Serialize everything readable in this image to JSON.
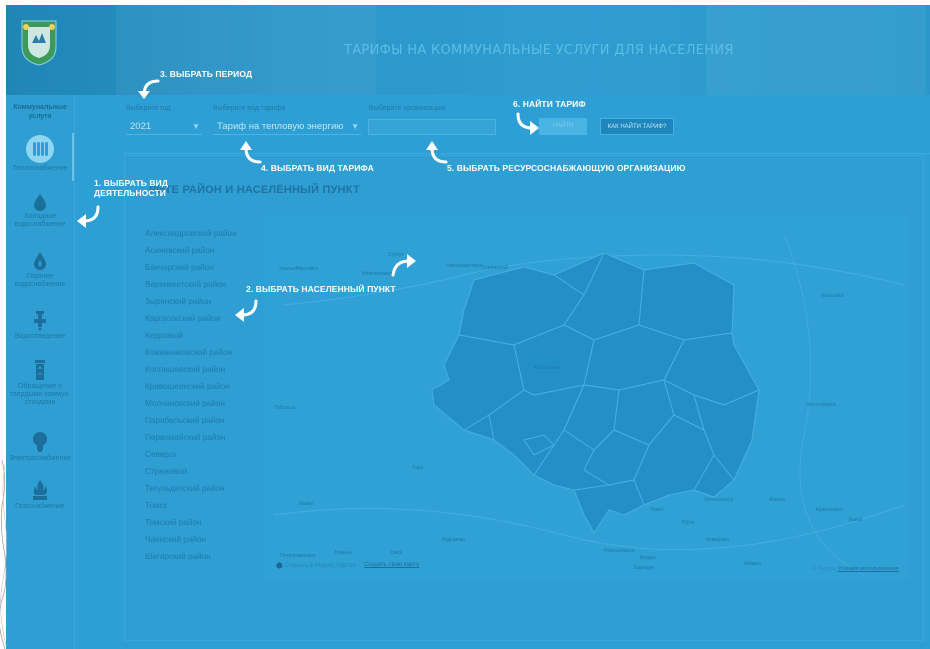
{
  "header": {
    "title": "ТАРИФЫ НА КОММУНАЛЬНЫЕ УСЛУГИ ДЛЯ НАСЕЛЕНИЯ"
  },
  "sidebar": {
    "heading": "Коммунальные услуги",
    "items": [
      {
        "label": "Теплоснабжение",
        "icon": "radiator-icon"
      },
      {
        "label": "Холодное водоснабжение",
        "icon": "cold-water-drop-icon"
      },
      {
        "label": "Горячее водоснабжение",
        "icon": "hot-water-drop-icon"
      },
      {
        "label": "Водоотведение",
        "icon": "faucet-icon"
      },
      {
        "label": "Обращение с твердыми коммун. отходами",
        "icon": "trash-bin-icon"
      },
      {
        "label": "Электроснабжение",
        "icon": "lightbulb-icon"
      },
      {
        "label": "Газоснабжение",
        "icon": "gas-flame-icon"
      }
    ]
  },
  "filters": {
    "year_label": "Выберите год",
    "year_value": "2021",
    "tariff_label": "Выберите вид тарифа",
    "tariff_value": "Тариф на тепловую энергию",
    "org_label": "Выберите организацию",
    "find_button": "НАЙТИ",
    "how_button": "КАК НАЙТИ ТАРИФ?"
  },
  "section_title": "РИТЕ РАЙОН И НАСЕЛЁННЫЙ ПУНКТ",
  "districts": [
    "Александровский район",
    "Асиновский район",
    "Бакчарский район",
    "Верхнекетский район",
    "Зырянский район",
    "Каргасокский район",
    "Кедровый",
    "Кожевниковский район",
    "Колпашевский район",
    "Кривошеинский район",
    "Молчановский район",
    "Парабельский район",
    "Первомайский район",
    "Северск",
    "Стрежевой",
    "Тегульдетский район",
    "Томск",
    "Томский район",
    "Чаинский район",
    "Шегарский район"
  ],
  "map": {
    "open_in_yandex": "Открыть в Яндекс.Картах",
    "create_map": "Создать свою карту",
    "yandex_terms_prefix": "© Яндекс",
    "yandex_terms_link": "Условия использования",
    "city_labels": [
      "Сургут",
      "Нижневартовск",
      "Нефтеюганск",
      "Ханты-Мансийск",
      "Енисейск",
      "Лесосибирск",
      "Красноярск",
      "Ачинск",
      "Новосибирск",
      "Омск",
      "Тара",
      "Кемерово",
      "Юрга",
      "Томск",
      "Барнаул",
      "Бердск",
      "Ишим",
      "Петропавловск",
      "Тобольск",
      "Тюмень",
      "Колпашево",
      "Стрежевой",
      "Канск",
      "Зеленогорск",
      "Кудымкар",
      "Абакан"
    ]
  },
  "instructions": {
    "step1": [
      "1. ВЫБРАТЬ ВИД",
      "ДЕЯТЕЛЬНОСТИ"
    ],
    "step2": "2. ВЫБРАТЬ НАСЕЛЕННЫЙ ПУНКТ",
    "step3": "3. ВЫБРАТЬ ПЕРИОД",
    "step4": "4. ВЫБРАТЬ ВИД ТАРИФА",
    "step5": "5. ВЫБРАТЬ РЕСУРСОСНАБЖАЮЩУЮ ОРГАНИЗАЦИЮ",
    "step6": "6. НАЙТИ ТАРИФ"
  },
  "colors": {
    "page_bg": "#2e9fd4",
    "header_bg": "#1f86b6",
    "region_fill": "#2290c6",
    "instruction_text": "#ffffff"
  }
}
